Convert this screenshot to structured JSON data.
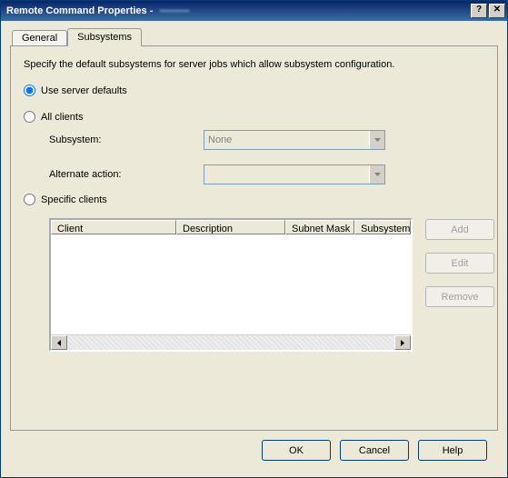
{
  "title": {
    "fixed": "Remote Command Properties - ",
    "obscured": "———"
  },
  "title_buttons": {
    "help": "?",
    "close": "✕"
  },
  "tabs": {
    "general": "General",
    "subsystems": "Subsystems",
    "active": "Subsystems"
  },
  "description": "Specify the default subsystems for server jobs which allow subsystem configuration.",
  "options": {
    "use_server_defaults": "Use server defaults",
    "all_clients": "All clients",
    "specific_clients": "Specific clients",
    "selected": "use_server_defaults"
  },
  "all_clients_fields": {
    "subsystem_label": "Subsystem:",
    "subsystem_value": "None",
    "alternate_label": "Alternate action:",
    "alternate_value": ""
  },
  "listview": {
    "columns": {
      "client": "Client",
      "description": "Description",
      "subnet_mask": "Subnet Mask",
      "subsystem": "Subsystem"
    }
  },
  "side_buttons": {
    "add": "Add",
    "edit": "Edit",
    "remove": "Remove"
  },
  "footer": {
    "ok": "OK",
    "cancel": "Cancel",
    "help": "Help"
  }
}
